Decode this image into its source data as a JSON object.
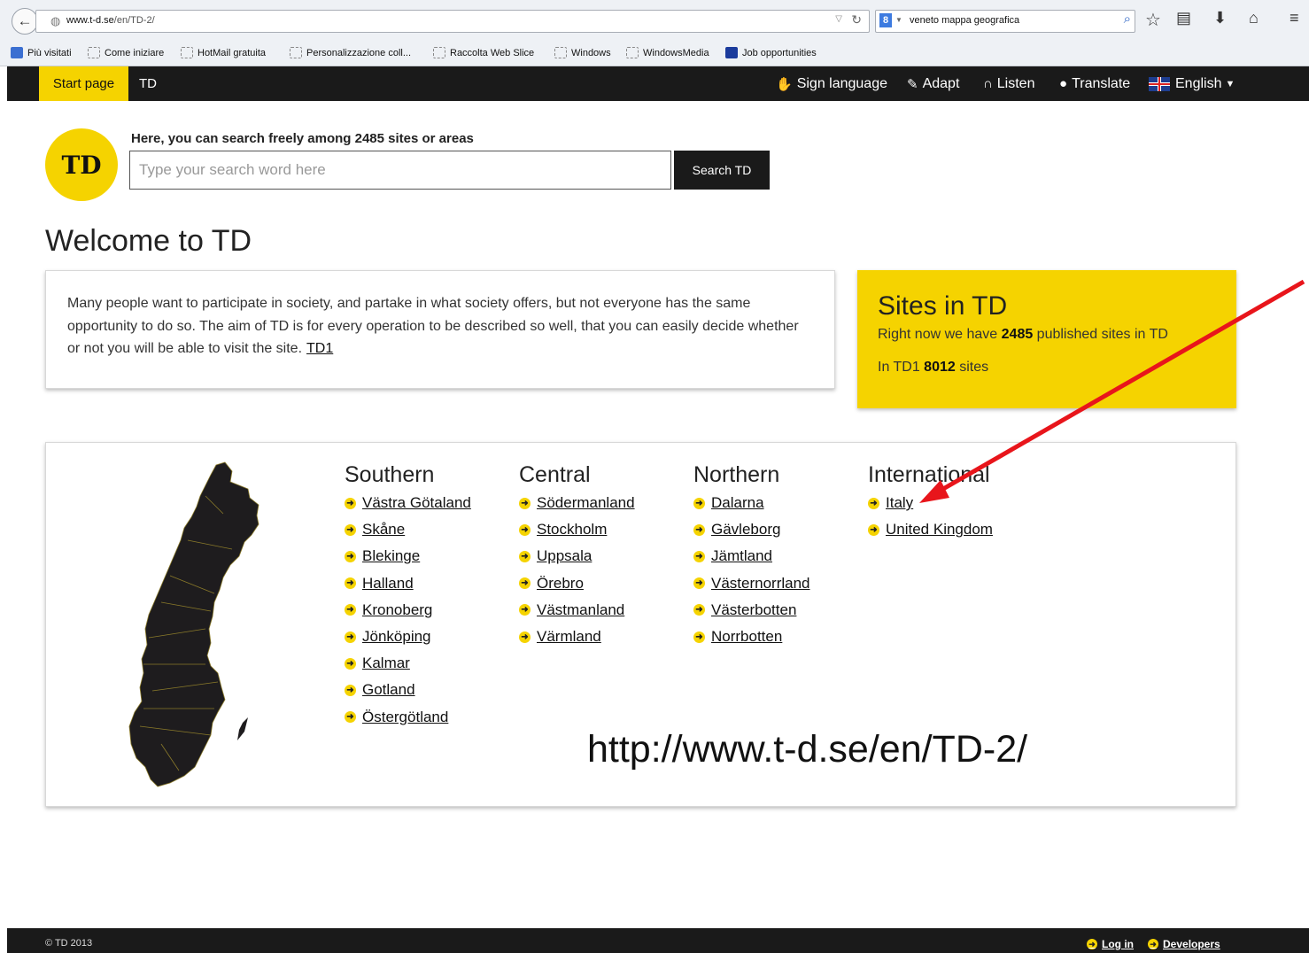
{
  "browser": {
    "url_host": "www.t-d.se",
    "url_path": "/en/TD-2/",
    "search_query": "veneto mappa geografica",
    "bookmarks": [
      "Più visitati",
      "Come iniziare",
      "HotMail gratuita",
      "Personalizzazione coll...",
      "Raccolta Web Slice",
      "Windows",
      "WindowsMedia",
      "Job opportunities"
    ]
  },
  "site_nav": {
    "start_page": "Start page",
    "td": "TD",
    "sign_language": "Sign language",
    "adapt": "Adapt",
    "listen": "Listen",
    "translate": "Translate",
    "language": "English"
  },
  "search": {
    "heading": "Here, you can search freely among 2485 sites or areas",
    "placeholder": "Type your search word here",
    "button": "Search TD"
  },
  "welcome": "Welcome to TD",
  "intro": {
    "text": "Many people want to participate in society, and partake in what society offers, but not everyone has the same opportunity to do so. The aim of TD is for every operation to be described so well, that you can easily decide whether or not you will be able to visit the site.",
    "link": "TD1"
  },
  "sites": {
    "title": "Sites in TD",
    "line1_pre": "Right now we have ",
    "line1_num": "2485",
    "line1_post": " published sites in TD",
    "line2_pre": "In TD1 ",
    "line2_num": "8012",
    "line2_post": " sites"
  },
  "regions": {
    "southern": {
      "title": "Southern",
      "items": [
        "Västra Götaland",
        "Skåne",
        "Blekinge",
        "Halland",
        "Kronoberg",
        "Jönköping",
        "Kalmar",
        "Gotland",
        "Östergötland"
      ]
    },
    "central": {
      "title": "Central",
      "items": [
        "Södermanland",
        "Stockholm",
        "Uppsala",
        "Örebro",
        "Västmanland",
        "Värmland"
      ]
    },
    "northern": {
      "title": "Northern",
      "items": [
        "Dalarna",
        "Gävleborg",
        "Jämtland",
        "Västernorrland",
        "Västerbotten",
        "Norrbotten"
      ]
    },
    "international": {
      "title": "International",
      "items": [
        "Italy",
        "United Kingdom"
      ]
    }
  },
  "overlay_url": "http://www.t-d.se/en/TD-2/",
  "footer": {
    "copyright": "© TD 2013",
    "login": "Log in",
    "developers": "Developers"
  },
  "colors": {
    "brand_yellow": "#f5d300",
    "dark": "#1a1a1a",
    "annotation_arrow": "#e8151b"
  }
}
